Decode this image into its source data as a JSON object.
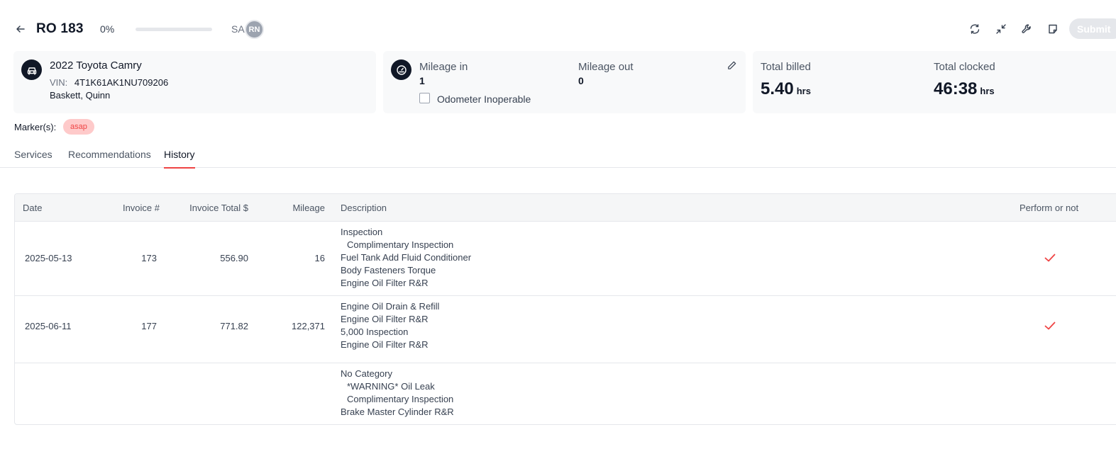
{
  "header": {
    "ro_title": "RO 183",
    "progress_label": "0%",
    "progress_fraction": 0,
    "sa_label": "SA",
    "avatar_initials": "RN",
    "submit_label": "Submit"
  },
  "vehicle": {
    "name": "2022 Toyota Camry",
    "vin_label": "VIN:",
    "vin": "4T1K61AK1NU709206",
    "owner": "Baskett, Quinn"
  },
  "mileage": {
    "in_label": "Mileage in",
    "in_value": "1",
    "out_label": "Mileage out",
    "out_value": "0",
    "odometer_label": "Odometer Inoperable"
  },
  "totals": {
    "billed_label": "Total billed",
    "billed_value": "5.40",
    "billed_unit": "hrs",
    "clocked_label": "Total clocked",
    "clocked_value": "46:38",
    "clocked_unit": "hrs"
  },
  "markers": {
    "label": "Marker(s):",
    "badge": "asap"
  },
  "tabs": [
    {
      "label": "Services"
    },
    {
      "label": "Recommendations"
    },
    {
      "label": "History"
    }
  ],
  "table": {
    "headers": {
      "date": "Date",
      "invoice": "Invoice #",
      "total": "Invoice Total $",
      "mileage": "Mileage",
      "description": "Description",
      "perform": "Perform or not"
    },
    "rows": [
      {
        "date": "2025-05-13",
        "invoice": "173",
        "total": "556.90",
        "mileage": "16",
        "desc": [
          "Inspection",
          "Complimentary Inspection",
          "Fuel Tank Add Fluid Conditioner",
          "Body Fasteners Torque",
          "Engine Oil Filter R&R"
        ],
        "performed": true
      },
      {
        "date": "2025-06-11",
        "invoice": "177",
        "total": "771.82",
        "mileage": "122,371",
        "desc": [
          "Engine Oil Drain & Refill",
          "Engine Oil Filter R&R",
          "5,000 Inspection",
          "Engine Oil Filter R&R"
        ],
        "performed": true
      },
      {
        "date": "",
        "invoice": "",
        "total": "",
        "mileage": "",
        "desc": [
          "No Category",
          "*WARNING* Oil Leak",
          "Complimentary Inspection",
          "Brake Master Cylinder R&R"
        ],
        "performed": false
      }
    ]
  },
  "colors": {
    "accent": "#ef4444",
    "badge_bg": "#fecaca",
    "card_bg": "#f8f9fa"
  },
  "icons": {
    "back": "arrow-left-icon",
    "refresh": "refresh-icon",
    "collapse": "collapse-arrows-icon",
    "wrench": "wrench-icon",
    "note": "note-icon",
    "car": "car-icon",
    "gauge": "speedometer-icon",
    "edit": "pencil-icon",
    "check": "checkmark-icon"
  }
}
